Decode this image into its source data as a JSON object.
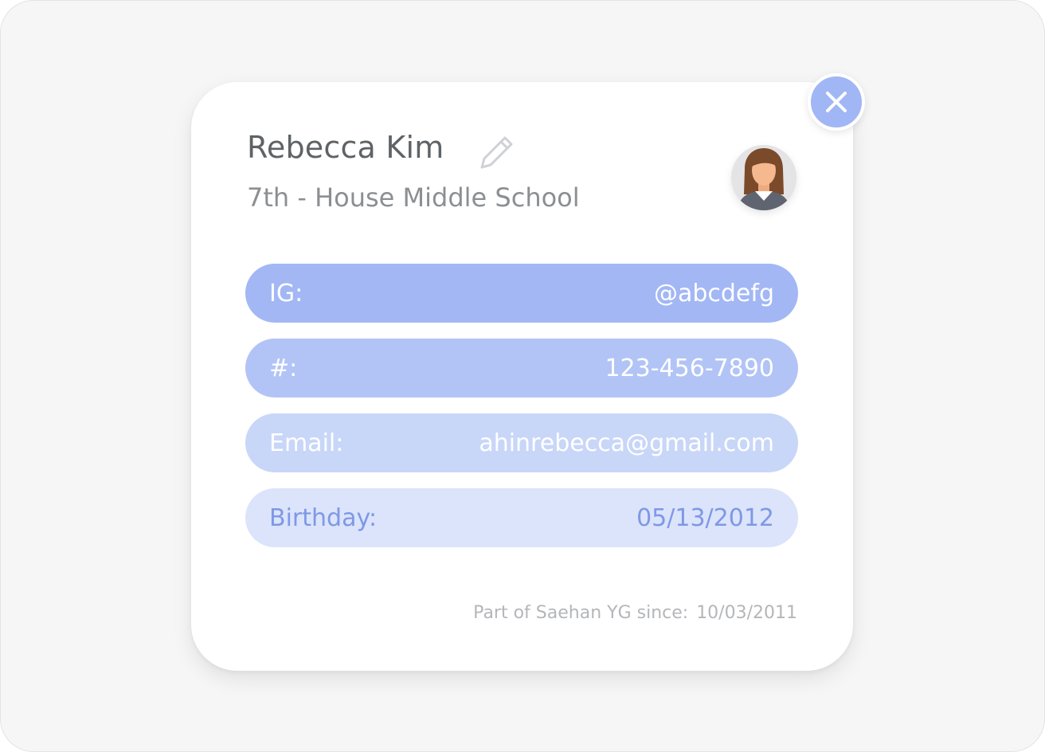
{
  "profile": {
    "name": "Rebecca Kim",
    "school": "7th - House Middle School"
  },
  "icons": {
    "edit": "pencil-icon",
    "close": "close-icon",
    "avatar": "avatar-woman"
  },
  "fields": {
    "ig": {
      "label": "IG:",
      "value": "@abcdefg"
    },
    "phone": {
      "label": "#:",
      "value": "123-456-7890"
    },
    "email": {
      "label": "Email:",
      "value": "ahinrebecca@gmail.com"
    },
    "birthday": {
      "label": "Birthday:",
      "value": "05/13/2012"
    }
  },
  "footer": {
    "label": "Part of Saehan YG since:",
    "date": "10/03/2011"
  },
  "colors": {
    "accent": "#a2b7f4",
    "close_button": "#a1b6f5",
    "birthday_text": "#7f98e6",
    "name_text": "#5f6366",
    "school_text": "#8c8f92",
    "footer_text": "#b4b6b9"
  }
}
